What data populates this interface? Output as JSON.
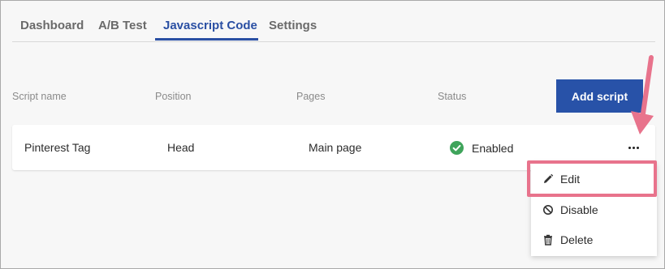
{
  "tabs": [
    {
      "label": "Dashboard"
    },
    {
      "label": "A/B Test"
    },
    {
      "label": "Javascript Code",
      "active": true
    },
    {
      "label": "Settings"
    }
  ],
  "table": {
    "headers": {
      "script_name": "Script name",
      "position": "Position",
      "pages": "Pages",
      "status": "Status"
    },
    "add_button": "Add script",
    "rows": [
      {
        "script_name": "Pinterest Tag",
        "position": "Head",
        "pages": "Main page",
        "status": "Enabled"
      }
    ]
  },
  "menu": {
    "items": [
      {
        "label": "Edit",
        "icon": "pencil-icon"
      },
      {
        "label": "Disable",
        "icon": "ban-icon"
      },
      {
        "label": "Delete",
        "icon": "trash-icon"
      }
    ]
  },
  "colors": {
    "accent": "#2a4fa3",
    "button": "#2852a8",
    "status_enabled": "#3fa45b",
    "highlight": "#e8738c"
  }
}
